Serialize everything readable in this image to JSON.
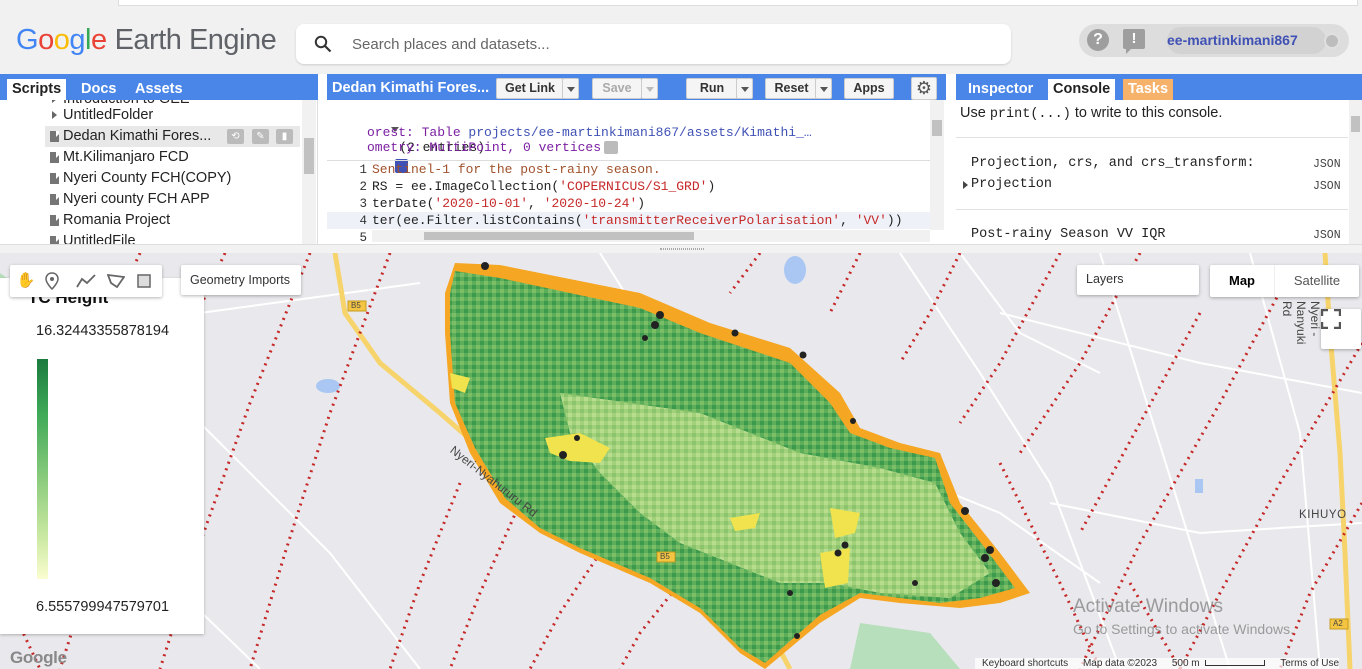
{
  "header": {
    "logo_google": "Google",
    "logo_product": "Earth Engine",
    "search_placeholder": "Search places and datasets...",
    "help_icon": "?",
    "feedback_icon": "!",
    "account_name": "ee-martinkimani867"
  },
  "left_panel": {
    "tabs": [
      "Scripts",
      "Docs",
      "Assets"
    ],
    "active_tab": "Scripts",
    "tree": [
      {
        "label": "Introduction to GEE",
        "type": "folder"
      },
      {
        "label": "UntitledFolder",
        "type": "folder"
      },
      {
        "label": "Dedan Kimathi Fores...",
        "type": "file",
        "selected": true
      },
      {
        "label": "Mt.Kilimanjaro FCD",
        "type": "file"
      },
      {
        "label": "Nyeri County FCH(COPY)",
        "type": "file"
      },
      {
        "label": "Nyeri county FCH APP",
        "type": "file"
      },
      {
        "label": "Romania Project",
        "type": "file"
      },
      {
        "label": "UntitledFile",
        "type": "file"
      }
    ]
  },
  "code_panel": {
    "title": "Dedan Kimathi Fores...",
    "buttons": {
      "get_link": "Get Link",
      "save": "Save",
      "run": "Run",
      "reset": "Reset",
      "apps": "Apps"
    },
    "imports_header": "(2 entries)",
    "imports": [
      {
        "prefix": "orest: Table ",
        "value": "projects/ee-martinkimani867/assets/Kimathi_…"
      },
      {
        "prefix": "ometry: MultiPoint, 0 vertices",
        "value": ""
      }
    ],
    "lines": [
      {
        "num": "1",
        "text": "Sentinel-1 for the post-rainy season."
      },
      {
        "num": "2",
        "a": "RS = ee.ImageCollection(",
        "s": "'COPERNICUS/S1_GRD'",
        "b": ")"
      },
      {
        "num": "3",
        "a": "terDate(",
        "s": "'2020-10-01'",
        "m": ", ",
        "s2": "'2020-10-24'",
        "b": ")"
      },
      {
        "num": "4",
        "a": "ter(ee.Filter.listContains(",
        "s": "'transmitterReceiverPolarisation'",
        "m": ", ",
        "s2": "'VV'",
        "b": "))"
      },
      {
        "num": "5",
        "text": ""
      }
    ]
  },
  "right_panel": {
    "tabs": [
      "Inspector",
      "Console",
      "Tasks"
    ],
    "active_tab": "Console",
    "hint_prefix": "Use ",
    "hint_code": "print(...)",
    "hint_suffix": " to write to this console.",
    "entries": [
      {
        "text": "Projection, crs, and crs_transform:",
        "tag": "JSON"
      },
      {
        "text": "Projection",
        "tag": "JSON",
        "expandable": true
      },
      {
        "text": "Post-rainy Season VV IQR",
        "tag": "JSON"
      }
    ]
  },
  "map": {
    "draw_tools": [
      "hand-icon",
      "marker-icon",
      "line-icon",
      "polygon-icon",
      "rectangle-icon"
    ],
    "geometry_imports": "Geometry Imports",
    "layers": "Layers",
    "map_type": {
      "map": "Map",
      "satellite": "Satellite",
      "selected": "Map"
    },
    "legend": {
      "title": "TC Height",
      "max": "16.32443355878194",
      "min": "6.555799947579701",
      "colors": [
        "#1b7a3e",
        "#3faa58",
        "#8ccc7e",
        "#c8e8a0",
        "#fbfdd0"
      ]
    },
    "labels": {
      "road_b5": "B5",
      "road_b5_2": "B5",
      "road_a2": "A2",
      "nyeri_nyahururu": "Nyeri-Nyahururu Rd",
      "nyeri_nanyuki": "Nyeri - Nanyuki Rd",
      "kihuyo": "KIHUYO"
    },
    "watermark_title": "Activate Windows",
    "watermark_sub": "Go to Settings to activate Windows.",
    "attribution": {
      "shortcuts": "Keyboard shortcuts",
      "data": "Map data ©2023",
      "scale": "500 m",
      "terms": "Terms of Use"
    },
    "google_mark": "Google"
  },
  "colors": {
    "panel_blue": "#4a86e8",
    "tasks_orange": "#f6b26b",
    "account_blue": "#3f51b5",
    "forest_orange": "#f5a623",
    "road_yellow": "#f7d46b",
    "dotted_red": "#c62828"
  }
}
